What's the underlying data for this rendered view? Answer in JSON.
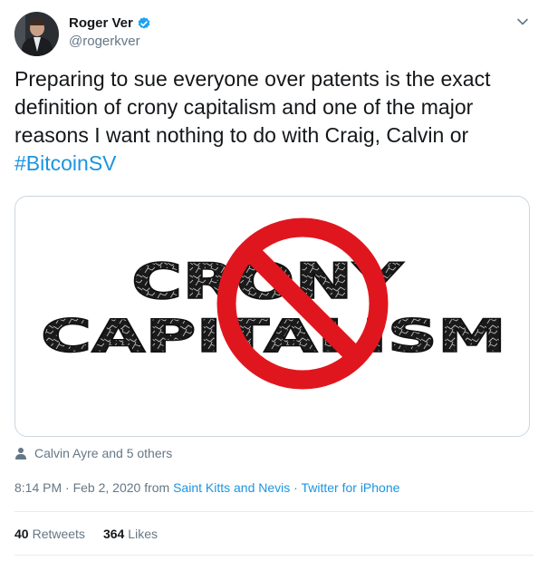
{
  "author": {
    "display_name": "Roger Ver",
    "handle": "@rogerkver"
  },
  "tweet": {
    "text_main": "Preparing to sue everyone over patents is the exact definition of crony capitalism and one of the major reasons I want nothing to do with Craig, Calvin or ",
    "hashtag": "#BitcoinSV"
  },
  "media": {
    "word1": "CRONY",
    "word2": "CAPITALISM",
    "sign_color": "#e0161e"
  },
  "tagged": "Calvin Ayre and 5 others",
  "meta": {
    "time_date": "8:14 PM · Feb 2, 2020 from ",
    "location": "Saint Kitts and Nevis",
    "separator": " · ",
    "source": "Twitter for iPhone"
  },
  "stats": {
    "retweets_count": "40",
    "retweets_label": "Retweets",
    "likes_count": "364",
    "likes_label": "Likes"
  },
  "colors": {
    "link": "#1b95e0",
    "secondary_text": "#657786",
    "verified": "#1da1f2"
  },
  "icons": [
    "verified-badge-icon",
    "chevron-down-icon",
    "person-icon"
  ]
}
